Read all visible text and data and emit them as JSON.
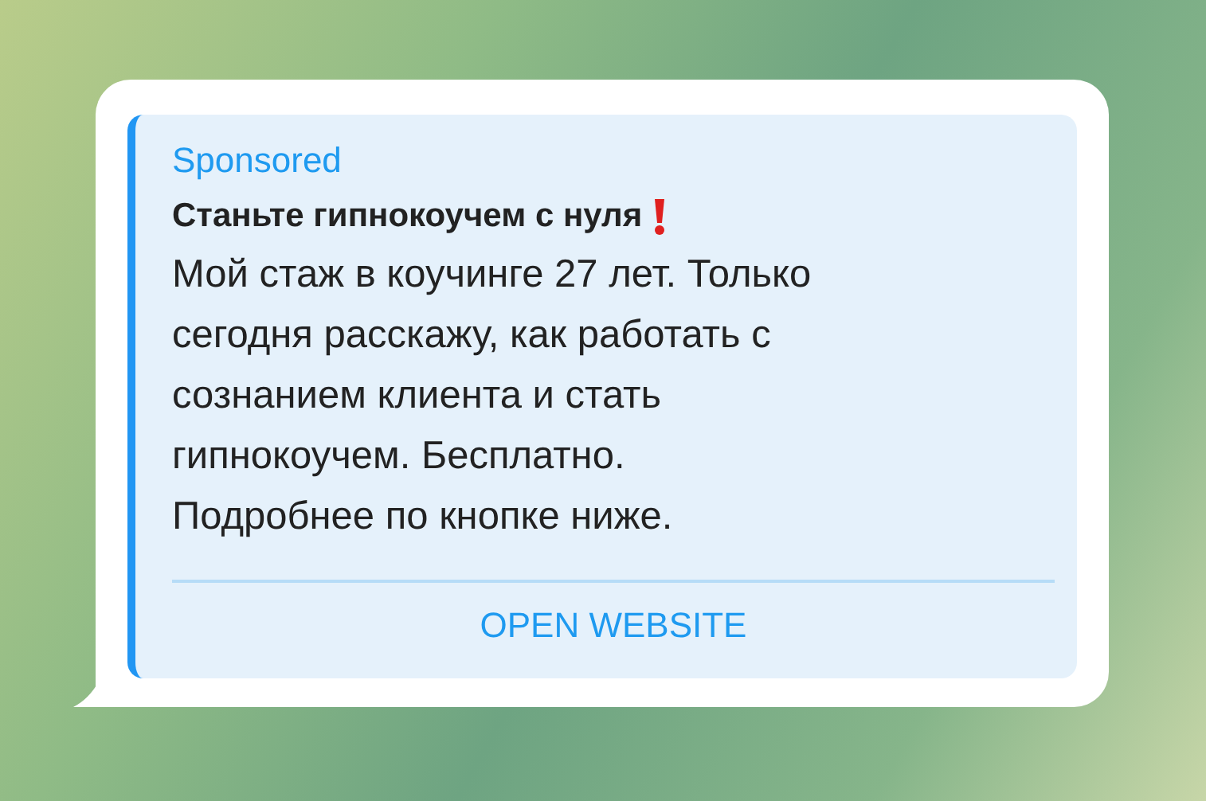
{
  "message": {
    "label": "Sponsored",
    "title": "Станьте гипнокоучем с нуля",
    "text": "Мой стаж в коучинге 27 лет. Только\nсегодня расскажу, как работать с\nсознанием клиента и стать\nгипнокоучем. Бесплатно.\nПодробнее по кнопке ниже.",
    "button": "OPEN WEBSITE"
  }
}
